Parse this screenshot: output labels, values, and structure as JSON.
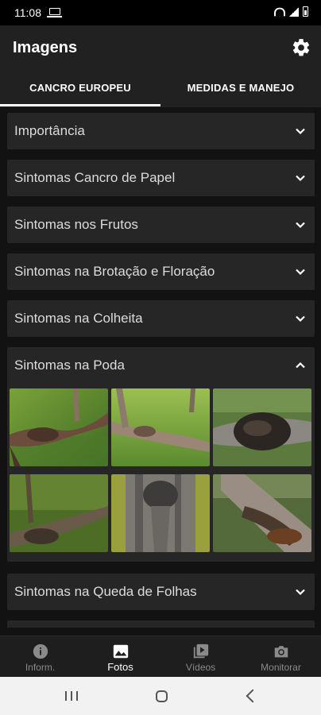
{
  "status_bar": {
    "time": "11:08"
  },
  "app_bar": {
    "title": "Imagens",
    "settings_icon": "gear-icon"
  },
  "tabs": [
    {
      "label": "CANCRO EUROPEU",
      "active": true
    },
    {
      "label": "MEDIDAS E MANEJO",
      "active": false
    }
  ],
  "sections": [
    {
      "label": "Importância",
      "expanded": false
    },
    {
      "label": "Sintomas Cancro de Papel",
      "expanded": false
    },
    {
      "label": "Sintomas nos Frutos",
      "expanded": false
    },
    {
      "label": "Sintomas na Brotação e Floração",
      "expanded": false
    },
    {
      "label": "Sintomas na Colheita",
      "expanded": false
    },
    {
      "label": "Sintomas na Poda",
      "expanded": true
    },
    {
      "label": "Sintomas na Queda de Folhas",
      "expanded": false
    }
  ],
  "poda_images": [
    {
      "name": "canker-branch-photo"
    },
    {
      "name": "canker-wound-branch-photo"
    },
    {
      "name": "canker-dark-bark-photo"
    },
    {
      "name": "canker-twig-green-photo"
    },
    {
      "name": "trunk-canker-photo"
    },
    {
      "name": "branch-decay-photo"
    }
  ],
  "bottom_nav": [
    {
      "label": "Inform.",
      "icon": "info-icon",
      "active": false
    },
    {
      "label": "Fotos",
      "icon": "photo-icon",
      "active": true
    },
    {
      "label": "Vídeos",
      "icon": "video-library-icon",
      "active": false
    },
    {
      "label": "Monitorar",
      "icon": "camera-icon",
      "active": false
    }
  ],
  "colors": {
    "background": "#121212",
    "app_bar": "#212121",
    "card": "#262626",
    "accent": "#ffffff",
    "nav_inactive": "#8a8a8a"
  }
}
